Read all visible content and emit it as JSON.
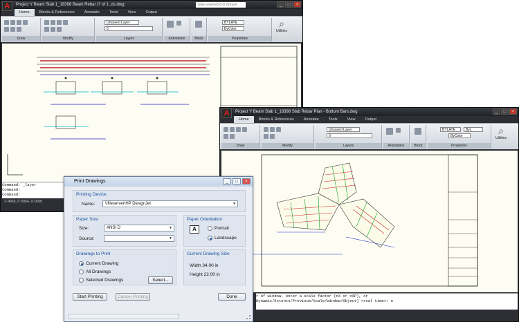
{
  "window1": {
    "title": "Project Y Beam Slab 1_18398 Beam Rebar (? of 1..ds.dwg",
    "search_placeholder": "Type a keyword or phrase",
    "tabs": [
      "Home",
      "Blocks & References",
      "Annotate",
      "Tools",
      "View",
      "Output"
    ],
    "panels": [
      "Draw",
      "Modify",
      "Layers",
      "Annotation",
      "Block",
      "Properties"
    ],
    "layer_combo": "Unsaved Layer",
    "layer_state": "0",
    "bylayer": "BYLAYE",
    "bycolor": "ByColor",
    "utilities": "Utilities",
    "command_lines": [
      "Command: _layer",
      "Command:",
      "Command:"
    ],
    "coords": "2'-4965, 0'-5064, 0'-0000"
  },
  "window2": {
    "title": "Project Y Beam Slab 1_18398 Slab Rebar Plan - Bottom Bars.dwg",
    "tabs": [
      "Home",
      "Blocks & References",
      "Annotate",
      "Tools",
      "View",
      "Output"
    ],
    "panels": [
      "Draw",
      "Modify",
      "Layers",
      "Annotation",
      "Block",
      "Properties"
    ],
    "layer_combo": "Unsaved Layer",
    "layer_state": "0",
    "bylayer": "BYLAYE",
    "bycolor": "ByColor",
    "byl": "ByL",
    "utilities": "Utilities",
    "command_lines": [
      "r of window, enter a scale factor (nX or nXP), or",
      "Dynamic/Extents/Previous/Scale/Window/Object] <real time>: e"
    ]
  },
  "dialog": {
    "title": "Print Drawings",
    "printing_device": {
      "heading": "Printing Device",
      "name_label": "Name:",
      "name_value": "\\\\fileserver\\HP DesignJet"
    },
    "paper_size": {
      "heading": "Paper Size",
      "size_label": "Size:",
      "size_value": "ANSI D",
      "source_label": "Source:",
      "source_value": ""
    },
    "orientation": {
      "heading": "Paper Orientation",
      "portrait": "Portrait",
      "landscape": "Landscape",
      "selected": "landscape"
    },
    "drawings": {
      "heading": "Drawings to Print",
      "current": "Current Drawing",
      "all": "All Drawings",
      "selected_drawings": "Selected Drawings",
      "select_button": "Select...",
      "selected": "current"
    },
    "size_info": {
      "heading": "Current Drawing Size",
      "width": "Width 34.00 in",
      "height": "Height 22.00 in"
    },
    "buttons": {
      "start": "Start Printing",
      "cancel": "Cancel Printing",
      "done": "Done"
    }
  }
}
